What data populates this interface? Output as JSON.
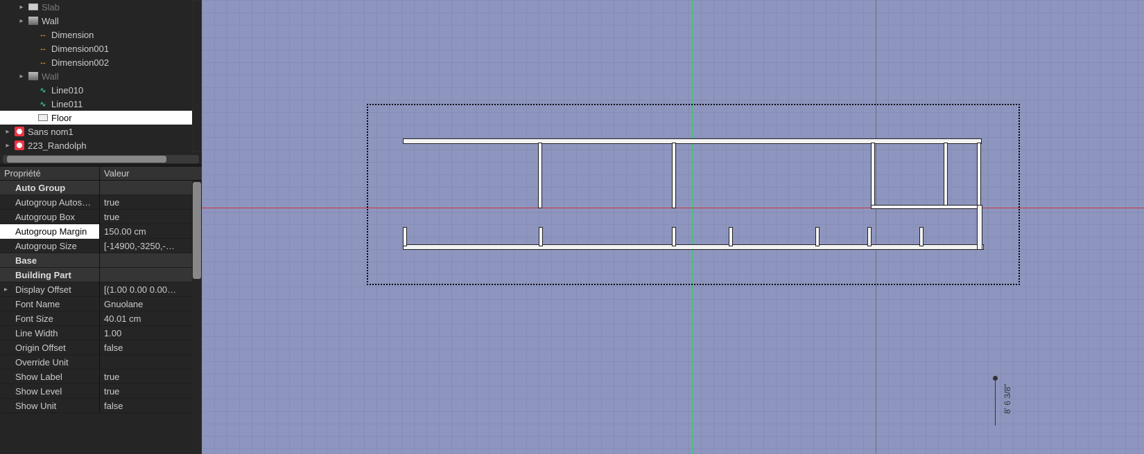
{
  "tree": {
    "items": [
      {
        "label": "Slab",
        "icon": "slab",
        "level": 1,
        "expander": "▸",
        "dim": true
      },
      {
        "label": "Wall",
        "icon": "wall",
        "level": 1,
        "expander": "▸",
        "dim": false
      },
      {
        "label": "Dimension",
        "icon": "dim",
        "level": 2,
        "expander": "",
        "dim": false
      },
      {
        "label": "Dimension001",
        "icon": "dim",
        "level": 2,
        "expander": "",
        "dim": false
      },
      {
        "label": "Dimension002",
        "icon": "dim",
        "level": 2,
        "expander": "",
        "dim": false
      },
      {
        "label": "Wall",
        "icon": "wall",
        "level": 1,
        "expander": "▸",
        "dim": true
      },
      {
        "label": "Line010",
        "icon": "line",
        "level": 2,
        "expander": "",
        "dim": false
      },
      {
        "label": "Line011",
        "icon": "line",
        "level": 2,
        "expander": "",
        "dim": false
      },
      {
        "label": "Floor",
        "icon": "floor",
        "level": 2,
        "expander": "",
        "dim": false,
        "selected": true
      },
      {
        "label": "Sans nom1",
        "icon": "fc",
        "level": 0,
        "expander": "▸",
        "dim": false
      },
      {
        "label": "223_Randolph",
        "icon": "fc",
        "level": 0,
        "expander": "▸",
        "dim": false
      }
    ]
  },
  "properties": {
    "header_name": "Propriété",
    "header_value": "Valeur",
    "rows": [
      {
        "group": true,
        "name": "Auto Group",
        "value": ""
      },
      {
        "group": false,
        "name": "Autogroup Autos…",
        "value": "true"
      },
      {
        "group": false,
        "name": "Autogroup Box",
        "value": "true"
      },
      {
        "group": false,
        "name": "Autogroup Margin",
        "value": "150.00 cm",
        "selected": true
      },
      {
        "group": false,
        "name": "Autogroup Size",
        "value": "[-14900,-3250,-…"
      },
      {
        "group": true,
        "name": "Base",
        "value": ""
      },
      {
        "group": true,
        "name": "Building Part",
        "value": ""
      },
      {
        "group": false,
        "name": "Display Offset",
        "value": "[(1.00 0.00 0.00…",
        "expander": "▸"
      },
      {
        "group": false,
        "name": "Font Name",
        "value": "Gnuolane"
      },
      {
        "group": false,
        "name": "Font Size",
        "value": "40.01 cm"
      },
      {
        "group": false,
        "name": "Line Width",
        "value": "1.00"
      },
      {
        "group": false,
        "name": "Origin Offset",
        "value": "false"
      },
      {
        "group": false,
        "name": "Override Unit",
        "value": ""
      },
      {
        "group": false,
        "name": "Show Label",
        "value": "true"
      },
      {
        "group": false,
        "name": "Show Level",
        "value": "true"
      },
      {
        "group": false,
        "name": "Show Unit",
        "value": "false"
      }
    ]
  },
  "viewport": {
    "dimension_label": "8' 6 3/8\""
  }
}
